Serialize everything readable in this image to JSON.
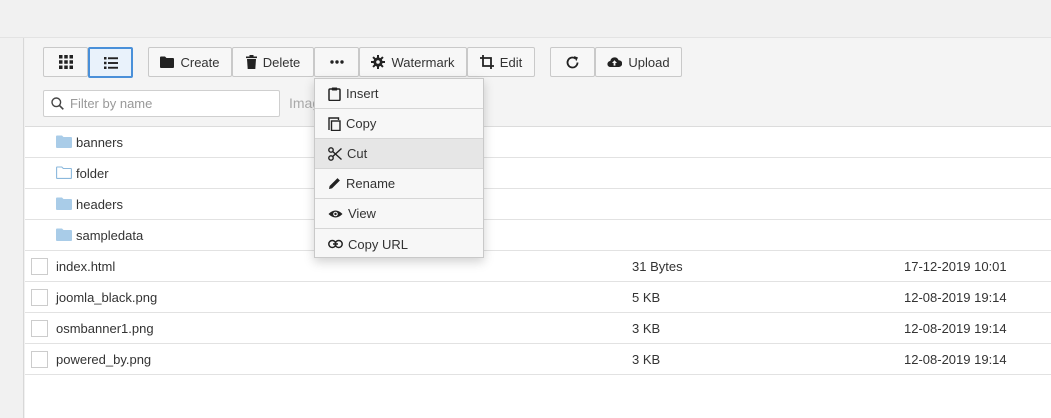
{
  "toolbar": {
    "create_label": "Create",
    "delete_label": "Delete",
    "watermark_label": "Watermark",
    "edit_label": "Edit",
    "upload_label": "Upload"
  },
  "search": {
    "placeholder": "Filter by name",
    "partial_label": "Imag"
  },
  "more_menu": {
    "items": [
      {
        "label": "Insert",
        "icon": "clipboard-icon"
      },
      {
        "label": "Copy",
        "icon": "copy-icon"
      },
      {
        "label": "Cut",
        "icon": "scissors-icon"
      },
      {
        "label": "Rename",
        "icon": "pencil-icon"
      },
      {
        "label": "View",
        "icon": "eye-icon"
      },
      {
        "label": "Copy URL",
        "icon": "link-icon"
      }
    ]
  },
  "folders": [
    {
      "name": "banners"
    },
    {
      "name": "folder"
    },
    {
      "name": "headers"
    },
    {
      "name": "sampledata"
    }
  ],
  "files": [
    {
      "name": "index.html",
      "size": "31 Bytes",
      "date": "17-12-2019 10:01"
    },
    {
      "name": "joomla_black.png",
      "size": "5 KB",
      "date": "12-08-2019 19:14"
    },
    {
      "name": "osmbanner1.png",
      "size": "3 KB",
      "date": "12-08-2019 19:14"
    },
    {
      "name": "powered_by.png",
      "size": "3 KB",
      "date": "12-08-2019 19:14"
    }
  ],
  "colors": {
    "folder": "#a9cce8",
    "active_border": "#4a90d9"
  }
}
